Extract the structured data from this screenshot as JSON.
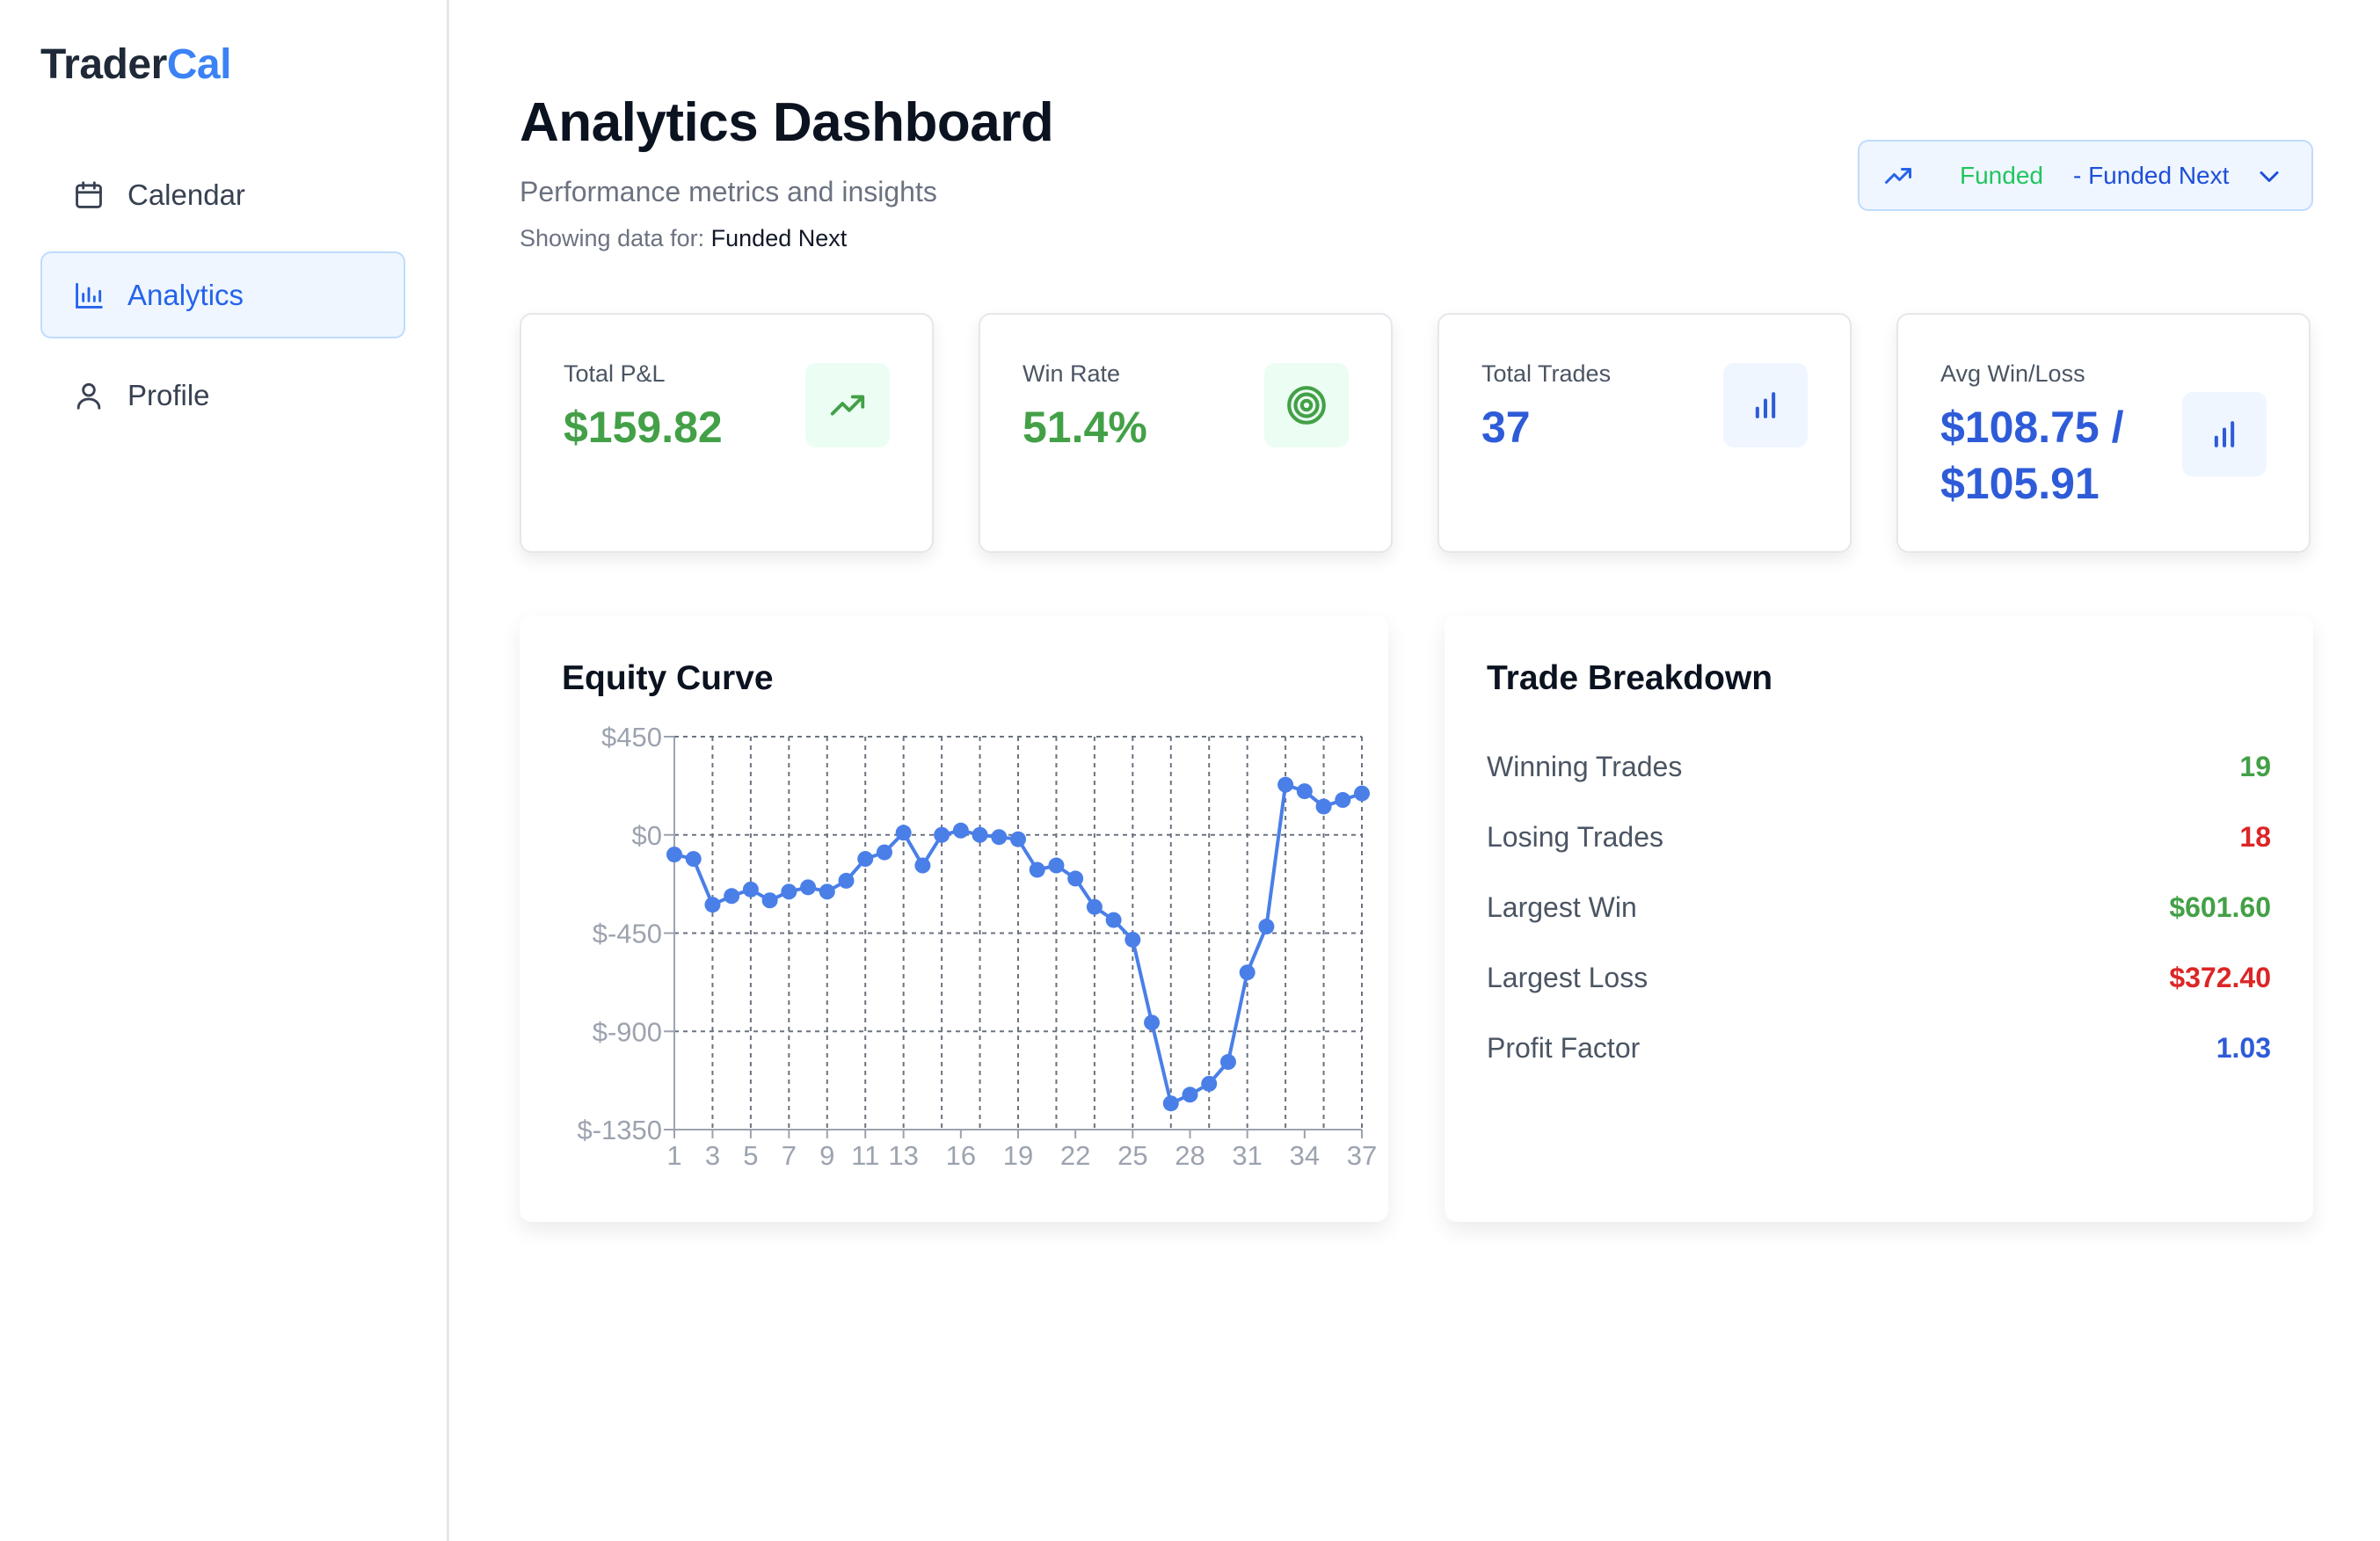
{
  "brand": {
    "part1": "Trader",
    "part2": "Cal"
  },
  "nav": [
    {
      "label": "Calendar",
      "icon": "calendar-icon",
      "active": false
    },
    {
      "label": "Analytics",
      "icon": "bar-chart-icon",
      "active": true
    },
    {
      "label": "Profile",
      "icon": "user-icon",
      "active": false
    }
  ],
  "header": {
    "title": "Analytics Dashboard",
    "subtitle": "Performance metrics and insights",
    "showing_prefix": "Showing data for:",
    "showing_account": "Funded Next"
  },
  "account_select": {
    "type": "Funded",
    "name": "- Funded Next",
    "icon": "trending-up-icon"
  },
  "stats": [
    {
      "label": "Total P&L",
      "value": "$159.82",
      "icon": "trending-up-icon",
      "tone": "green"
    },
    {
      "label": "Win Rate",
      "value": "51.4%",
      "icon": "target-icon",
      "tone": "green"
    },
    {
      "label": "Total Trades",
      "value": "37",
      "icon": "bar-chart-icon",
      "tone": "blue"
    },
    {
      "label": "Avg Win/Loss",
      "value_line1": "$108.75 /",
      "value_line2": "$105.91",
      "icon": "bar-chart-icon",
      "tone": "blue"
    }
  ],
  "equity": {
    "title": "Equity Curve"
  },
  "chart_data": {
    "type": "line",
    "title": "Equity Curve",
    "xlabel": "",
    "ylabel": "",
    "x": [
      1,
      2,
      3,
      4,
      5,
      6,
      7,
      8,
      9,
      10,
      11,
      12,
      13,
      14,
      15,
      16,
      17,
      18,
      19,
      20,
      21,
      22,
      23,
      24,
      25,
      26,
      27,
      28,
      29,
      30,
      31,
      32,
      33,
      34,
      35,
      36,
      37
    ],
    "x_tick_labels": [
      "1",
      "3",
      "5",
      "7",
      "9",
      "11",
      "13",
      "16",
      "19",
      "22",
      "25",
      "28",
      "31",
      "34",
      "37"
    ],
    "y_tick_labels": [
      "$450",
      "$0",
      "$-450",
      "$-900",
      "$-1350"
    ],
    "ylim": [
      -1350,
      450
    ],
    "series": [
      {
        "values": [
          -90,
          -110,
          -320,
          -280,
          -250,
          -300,
          -260,
          -240,
          -260,
          -210,
          -110,
          -80,
          10,
          -140,
          0,
          20,
          0,
          -10,
          -20,
          -160,
          -140,
          -200,
          -330,
          -390,
          -480,
          -860,
          -1230,
          -1190,
          -1140,
          -1040,
          -630,
          -420,
          230,
          200,
          130,
          160,
          190
        ]
      }
    ],
    "grid": true,
    "line_color": "#4a7fe8"
  },
  "breakdown": {
    "title": "Trade Breakdown",
    "rows": [
      {
        "label": "Winning Trades",
        "value": "19",
        "tone": "green"
      },
      {
        "label": "Losing Trades",
        "value": "18",
        "tone": "red"
      },
      {
        "label": "Largest Win",
        "value": "$601.60",
        "tone": "green"
      },
      {
        "label": "Largest Loss",
        "value": "$372.40",
        "tone": "red"
      },
      {
        "label": "Profit Factor",
        "value": "1.03",
        "tone": "blue"
      }
    ]
  },
  "colors": {
    "accent": "#3b82f6",
    "green": "#43a047",
    "red": "#dc2626",
    "blue": "#2e5bd8"
  }
}
